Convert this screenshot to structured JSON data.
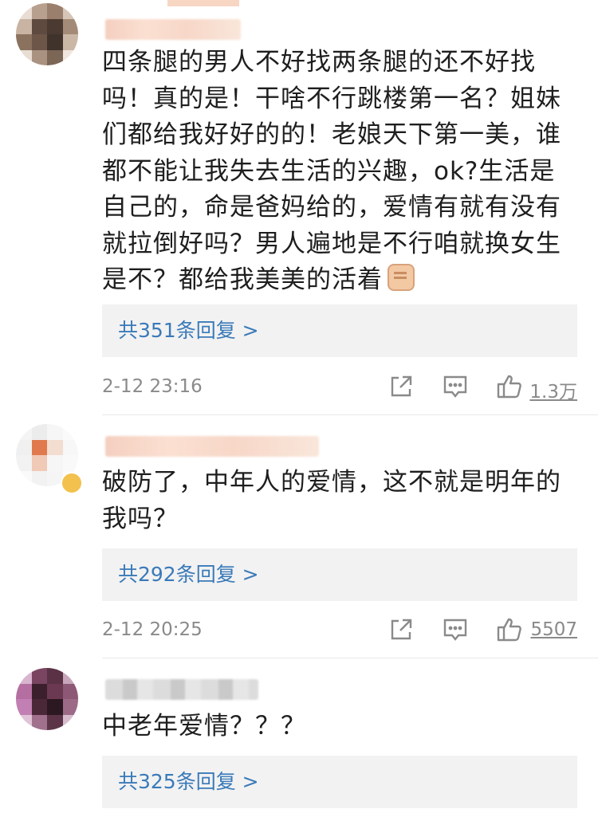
{
  "comments": [
    {
      "text": "四条腿的男人不好找两条腿的还不好找吗！真的是！干啥不行跳楼第一名？姐妹们都给我好好的的！老娘天下第一美，谁都不能让我失去生活的兴趣，ok?生活是自己的，命是爸妈给的，爱情有就有没有就拉倒好吗？男人遍地是不行咱就换女生是不？都给我美美的活着",
      "emoji": "fist-emoji",
      "replies_label": "共351条回复 >",
      "time": "2-12 23:16",
      "likes": "1.3万"
    },
    {
      "text": "破防了，中年人的爱情，这不就是明年的我吗？",
      "replies_label": "共292条回复 >",
      "time": "2-12 20:25",
      "likes": "5507"
    },
    {
      "text": "中老年爱情？？？",
      "replies_label": "共325条回复 >"
    }
  ],
  "icons": {
    "share": "share-icon",
    "comment": "comment-icon",
    "like": "thumbs-up-icon"
  },
  "colors": {
    "link": "#3a7ab9",
    "meta": "#8a8a8a",
    "reply_bg": "#f2f2f2"
  }
}
